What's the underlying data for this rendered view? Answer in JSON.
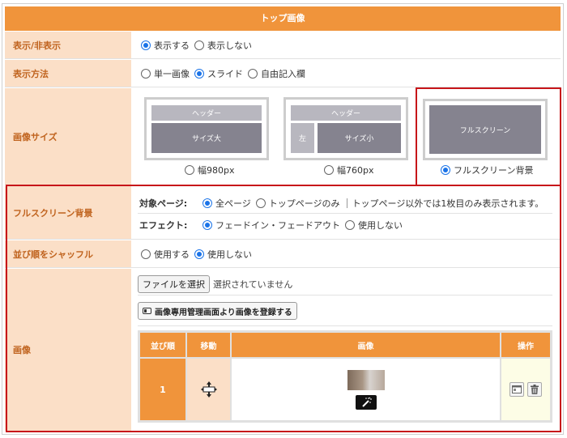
{
  "header": {
    "title": "トップ画像"
  },
  "display": {
    "label": "表示/非表示",
    "options": [
      {
        "label": "表示する",
        "selected": true
      },
      {
        "label": "表示しない",
        "selected": false
      }
    ]
  },
  "method": {
    "label": "表示方法",
    "options": [
      {
        "label": "単一画像",
        "selected": false
      },
      {
        "label": "スライド",
        "selected": true
      },
      {
        "label": "自由記入欄",
        "selected": false
      }
    ]
  },
  "size": {
    "label": "画像サイズ",
    "thumb_header": "ヘッダー",
    "thumb_large": "サイズ大",
    "thumb_left": "左",
    "thumb_small": "サイズ小",
    "thumb_full": "フルスクリーン",
    "options": [
      {
        "label": "幅980px",
        "selected": false
      },
      {
        "label": "幅760px",
        "selected": false
      },
      {
        "label": "フルスクリーン背景",
        "selected": true
      }
    ]
  },
  "fullbg": {
    "label": "フルスクリーン背景",
    "target_label": "対象ページ:",
    "target_options": [
      {
        "label": "全ページ",
        "selected": true
      },
      {
        "label": "トップページのみ",
        "selected": false
      }
    ],
    "target_note": "トップページ以外では1枚目のみ表示されます。",
    "effect_label": "エフェクト:",
    "effect_options": [
      {
        "label": "フェードイン・フェードアウト",
        "selected": true
      },
      {
        "label": "使用しない",
        "selected": false
      }
    ]
  },
  "shuffle": {
    "label": "並び順をシャッフル",
    "options": [
      {
        "label": "使用する",
        "selected": false
      },
      {
        "label": "使用しない",
        "selected": true
      }
    ]
  },
  "image": {
    "label": "画像",
    "file_button": "ファイルを選択",
    "file_status": "選択されていません",
    "register_button": "画像専用管理画面より画像を登録する",
    "table": {
      "headers": {
        "order": "並び順",
        "move": "移動",
        "image": "画像",
        "action": "操作"
      },
      "rows": [
        {
          "order": "1"
        }
      ]
    }
  },
  "colors": {
    "accent": "#f0943b",
    "label_bg": "#fbdfc7",
    "label_text": "#c0631e",
    "highlight": "#c7161a",
    "radio": "#1a73e8"
  }
}
